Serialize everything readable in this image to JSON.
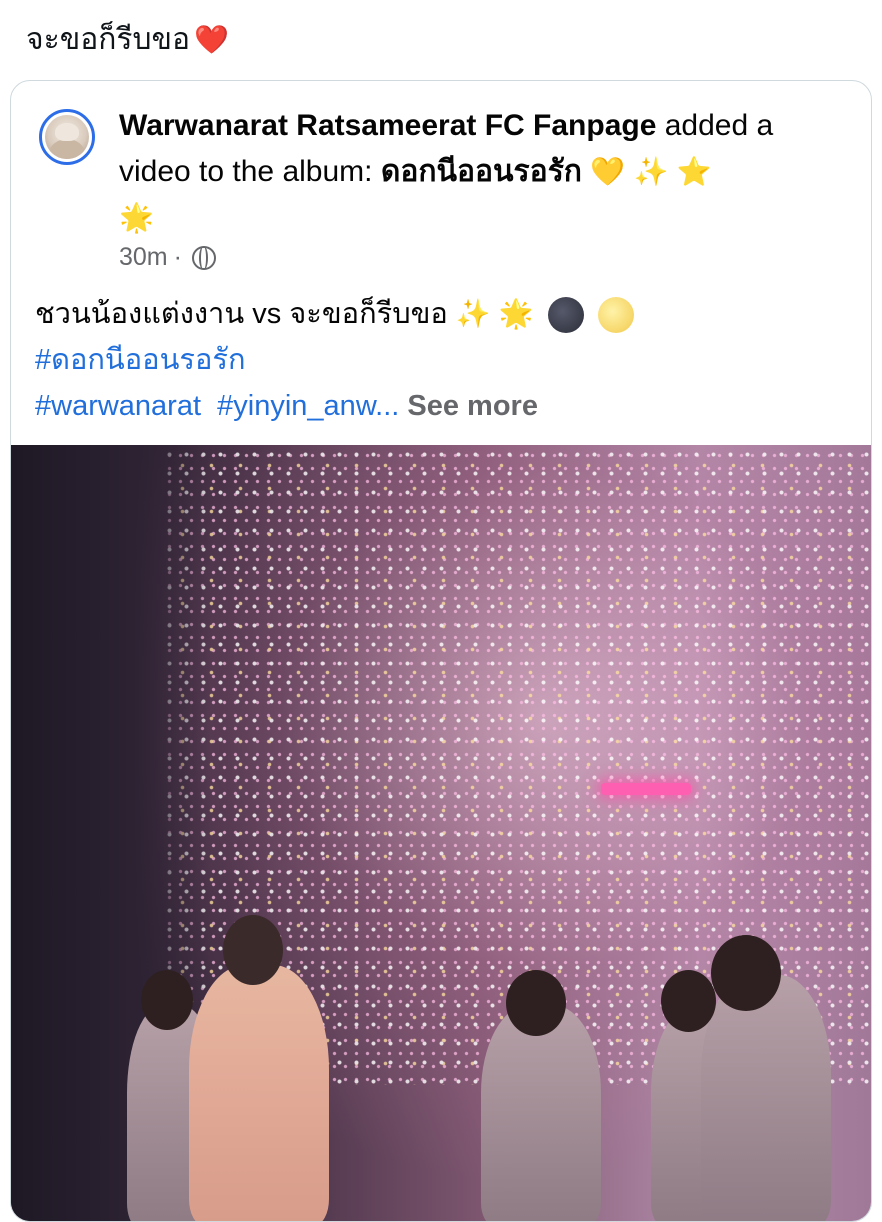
{
  "tweet": {
    "text": "จะขอก็รีบขอ",
    "heart": "❤️"
  },
  "post": {
    "author": "Warwanarat Ratsameerat FC Fanpage",
    "action": "added a video to the album:",
    "album": "ดอกนีออนรอรัก",
    "album_emojis": [
      "💛",
      "✨",
      "⭐",
      "🌟"
    ],
    "time": "30m",
    "visibility_separator": "·",
    "visibility_icon": "globe-icon",
    "caption": "ชวนน้องแต่งงาน vs จะขอก็รีบขอ",
    "caption_emojis": [
      "✨",
      "🌟",
      "🌑",
      "🌝"
    ],
    "hashtag_1": "#ดอกนีออนรอรัก",
    "hashtag_2": "#warwanarat",
    "hashtag_3": "#yinyin_anw...",
    "see_more": "See more"
  },
  "colors": {
    "link": "#216fdb",
    "avatar_ring": "#2d6ee8",
    "muted": "#65676b"
  }
}
